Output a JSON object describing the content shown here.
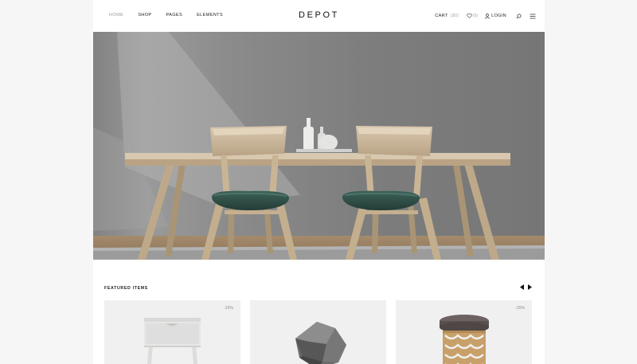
{
  "nav": {
    "items": [
      {
        "label": "HOME",
        "active": true
      },
      {
        "label": "SHOP",
        "active": false
      },
      {
        "label": "PAGES",
        "active": false
      },
      {
        "label": "ELEMENTS",
        "active": false
      }
    ]
  },
  "brand": {
    "logo": "DEPOT"
  },
  "header_right": {
    "cart_label": "CART",
    "cart_count": "($0)",
    "wishlist_count": "(0)",
    "login_label": "LOGIN",
    "search_icon": "search-icon",
    "menu_icon": "hamburger-menu-icon"
  },
  "hero": {
    "image": "dining-table-chairs-concrete-wall"
  },
  "featured": {
    "title": "FEATURED ITEMS",
    "prev_icon": "triangle-left-icon",
    "next_icon": "triangle-right-icon",
    "products": [
      {
        "badge": "-15%",
        "image": "white-nightstand"
      },
      {
        "badge": "",
        "image": "metal-geometric-sculpture"
      },
      {
        "badge": "-15%",
        "image": "gold-lattice-stool"
      }
    ]
  },
  "colors": {
    "page_bg": "#f6f6f6",
    "content_bg": "#ffffff",
    "card_bg": "#f0f0f0",
    "muted_text": "#a8a8a8",
    "text": "#222222",
    "seat_green": "#2f4f47"
  }
}
